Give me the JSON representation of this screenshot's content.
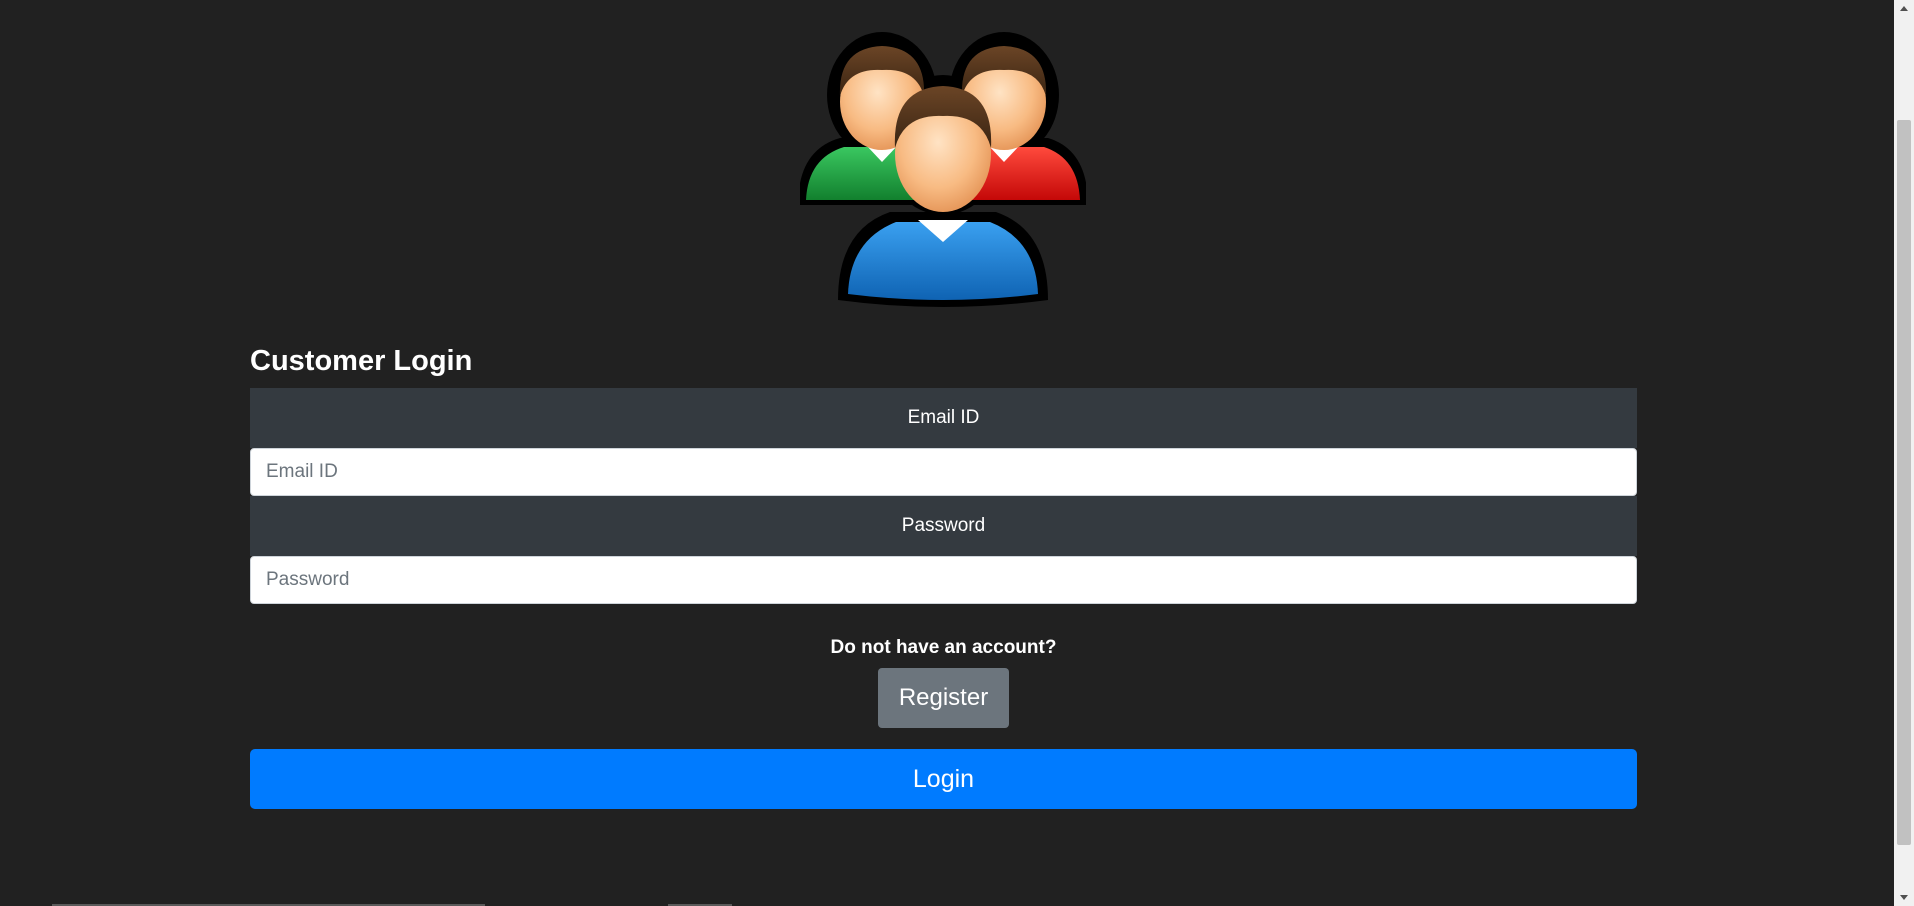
{
  "page": {
    "title": "Customer Login",
    "logo_icon": "users-group-icon"
  },
  "form": {
    "email": {
      "label": "Email ID",
      "placeholder": "Email ID",
      "value": ""
    },
    "password": {
      "label": "Password",
      "placeholder": "Password",
      "value": ""
    }
  },
  "register": {
    "prompt": "Do not have an account?",
    "button_label": "Register"
  },
  "login": {
    "button_label": "Login"
  },
  "colors": {
    "background": "#212121",
    "field_header": "#343a40",
    "login_button": "#007bff",
    "register_button": "#6c757d",
    "person_green": "#1a9b3c",
    "person_red": "#e01010",
    "person_blue": "#1a7fd1"
  }
}
